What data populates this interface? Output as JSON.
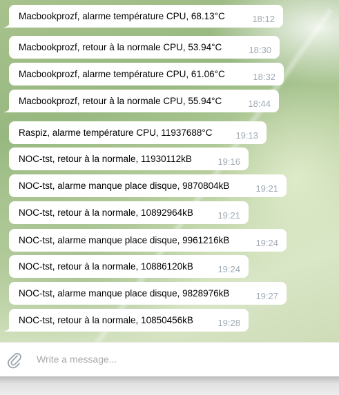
{
  "messages": [
    {
      "text": "Macbookprozf, alarme température CPU, 68.13°C",
      "time": "18:12"
    },
    {
      "text": "Macbookprozf, retour à la normale CPU, 53.94°C",
      "time": "18:30"
    },
    {
      "text": "Macbookprozf, alarme température CPU, 61.06°C",
      "time": "18:32"
    },
    {
      "text": "Macbookprozf, retour à la normale CPU, 55.94°C",
      "time": "18:44"
    },
    {
      "text": "Raspiz, alarme température CPU, 11937688°C",
      "time": "19:13"
    },
    {
      "text": "NOC-tst, retour à la normale, 11930112kB",
      "time": "19:16"
    },
    {
      "text": "NOC-tst, alarme manque place disque, 9870804kB",
      "time": "19:21"
    },
    {
      "text": "NOC-tst, retour à la normale, 10892964kB",
      "time": "19:21"
    },
    {
      "text": "NOC-tst, alarme manque place disque, 9961216kB",
      "time": "19:24"
    },
    {
      "text": "NOC-tst, retour à la normale, 10886120kB",
      "time": "19:24"
    },
    {
      "text": "NOC-tst, alarme manque place disque, 9828976kB",
      "time": "19:27"
    },
    {
      "text": "NOC-tst, retour à la normale, 10850456kB",
      "time": "19:28"
    }
  ],
  "composer": {
    "placeholder": "Write a message...",
    "attach_icon": "paperclip-icon"
  },
  "colors": {
    "bubble": "#ffffff",
    "time": "#a0aab4",
    "placeholder": "#a9a9a9"
  }
}
